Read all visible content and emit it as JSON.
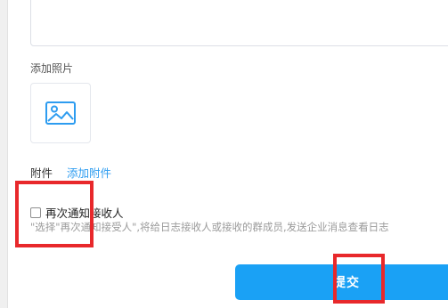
{
  "form": {
    "photo_label": "添加照片",
    "attachment_label": "附件",
    "add_attachment_link": "添加附件",
    "notify_again_label": "再次通知接收人",
    "notify_hint": "\"选择\"再次通知接受人\",将给日志接收人或接收的群成员,发送企业消息查看日志",
    "submit_label": "提交"
  },
  "icons": {
    "photo_icon": "image-icon"
  },
  "colors": {
    "accent": "#1aa1f5",
    "link": "#2d9cf0",
    "highlight": "#e8282b",
    "hint": "#9a9a9a"
  }
}
